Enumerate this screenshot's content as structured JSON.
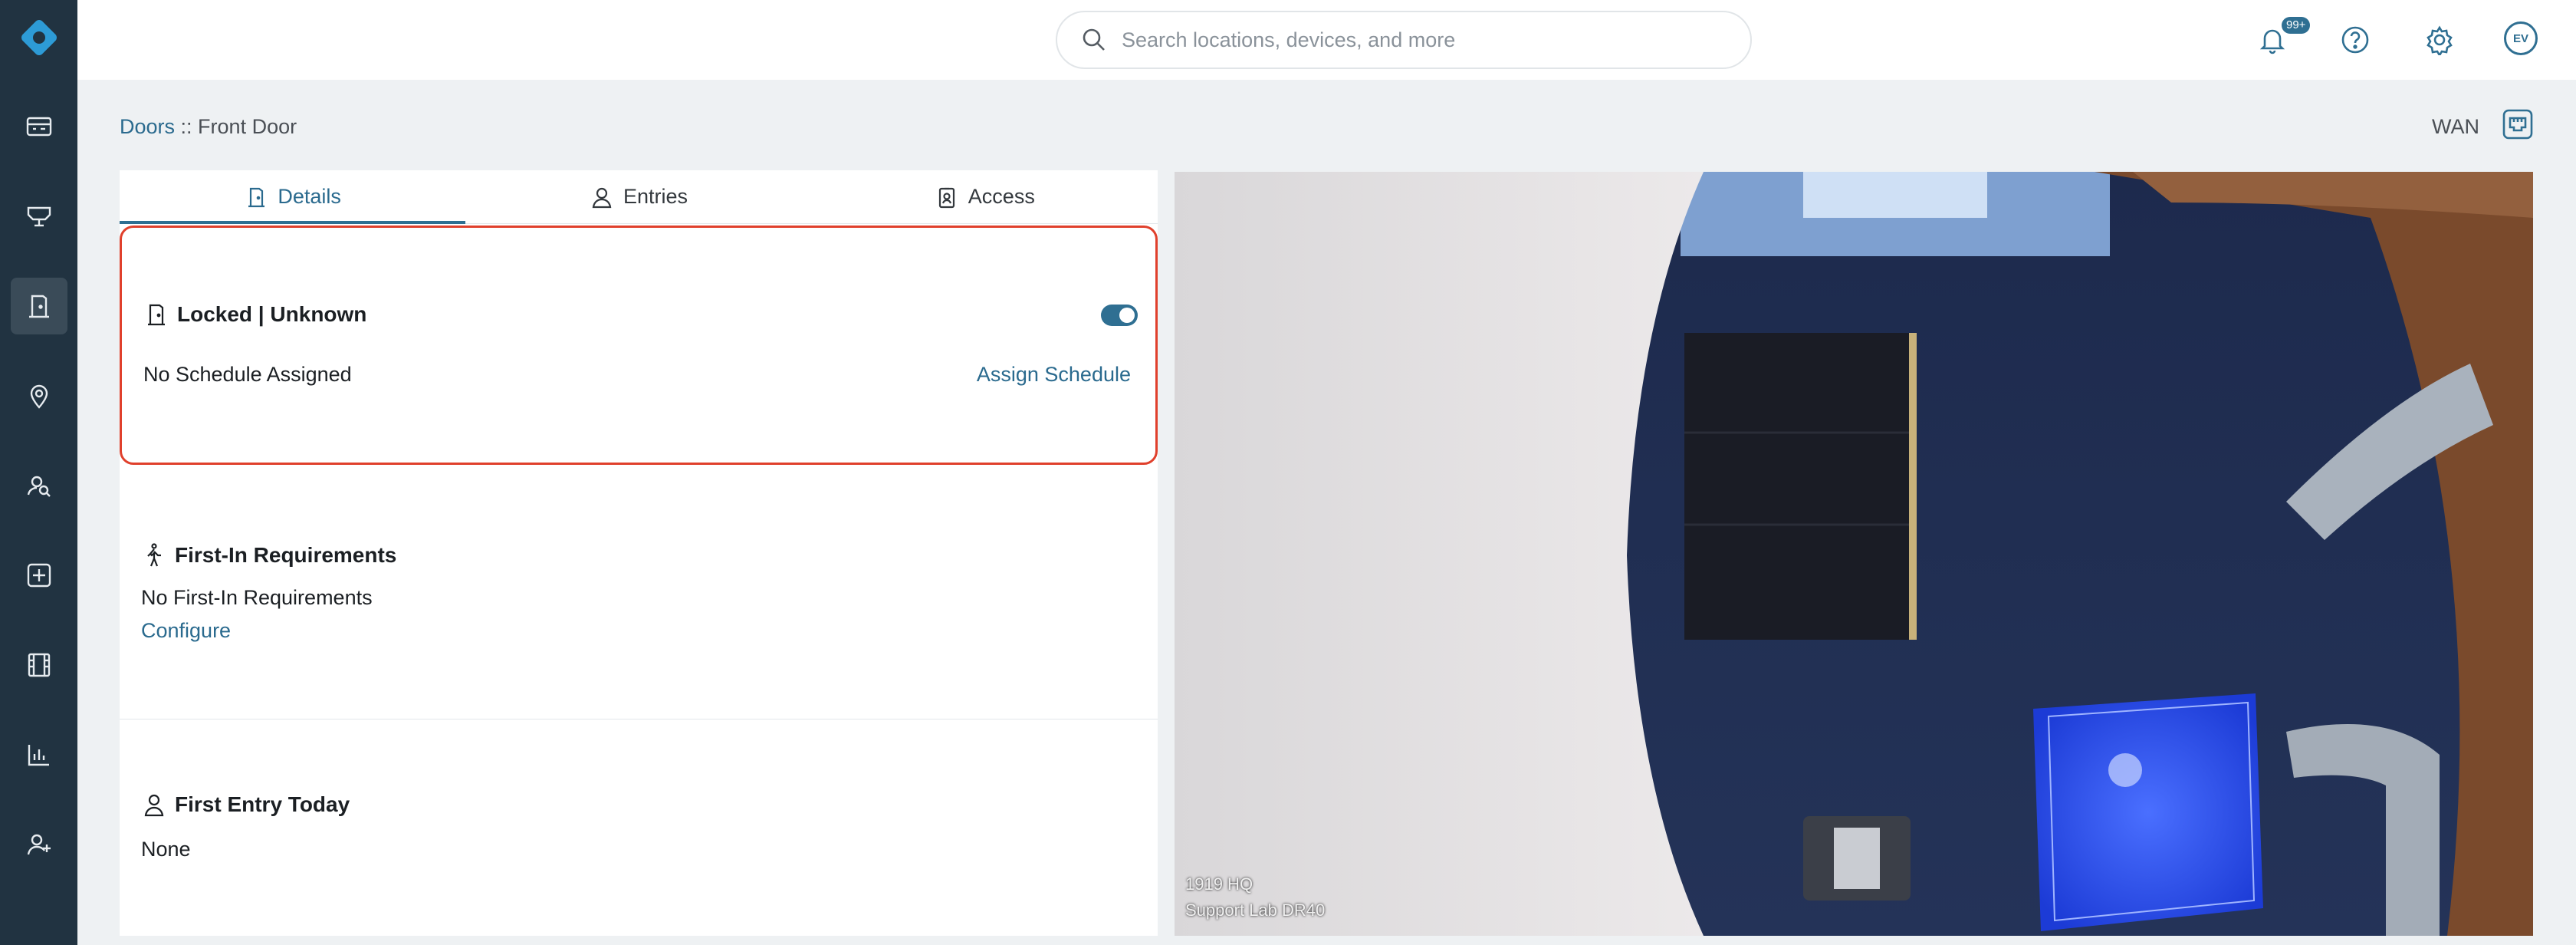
{
  "search": {
    "placeholder": "Search locations, devices, and more"
  },
  "notifications": {
    "badge": "99+"
  },
  "user": {
    "initials": "EV"
  },
  "breadcrumb": {
    "parent": "Doors",
    "separator": " :: ",
    "current": "Front Door"
  },
  "network": {
    "label": "WAN"
  },
  "tabs": [
    {
      "label": "Details",
      "icon": "door-icon"
    },
    {
      "label": "Entries",
      "icon": "person-icon"
    },
    {
      "label": "Access",
      "icon": "badge-icon"
    }
  ],
  "lock": {
    "status": "Locked | Unknown",
    "toggle_on": true,
    "schedule_text": "No Schedule Assigned",
    "assign_label": "Assign Schedule"
  },
  "first_in": {
    "title": "First-In Requirements",
    "text": "No First-In Requirements",
    "configure_label": "Configure"
  },
  "first_entry": {
    "title": "First Entry Today",
    "value": "None"
  },
  "camera": {
    "line1": "1919 HQ",
    "line2": "Support Lab DR40"
  },
  "colors": {
    "sidebar": "#213341",
    "accent": "#2f6f92",
    "highlight": "#e0402c"
  }
}
